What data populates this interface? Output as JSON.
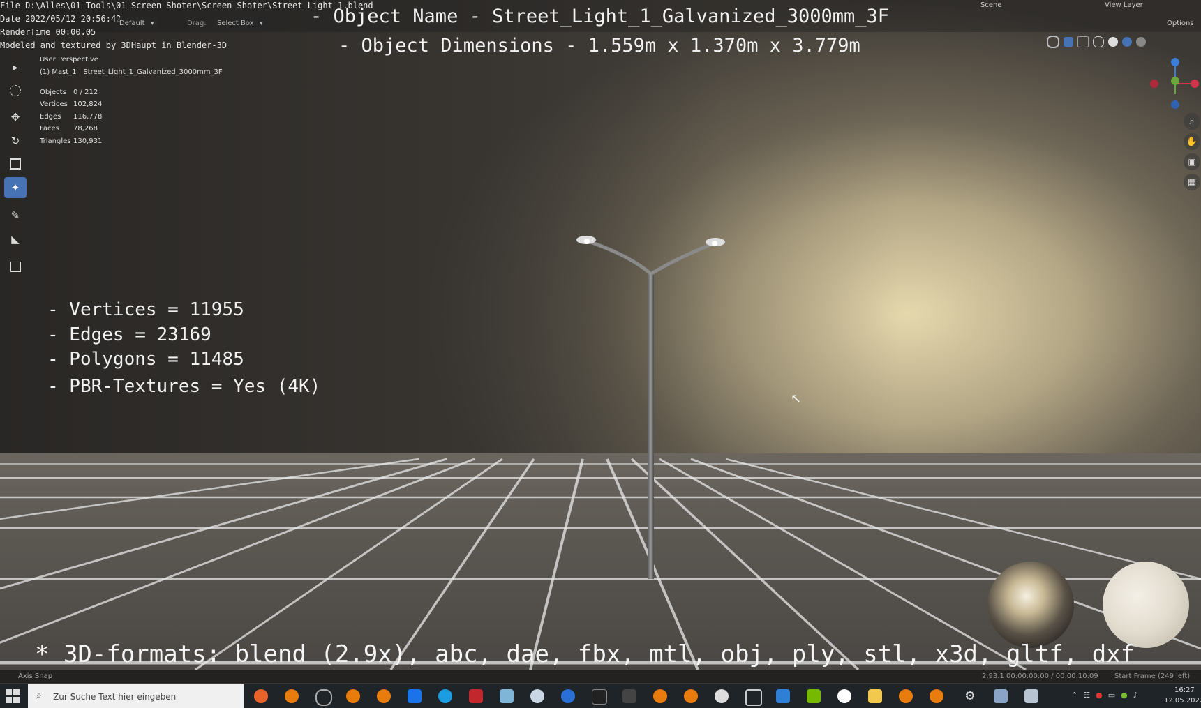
{
  "window": {
    "file_path": "File D:\\Alles\\01_Tools\\01_Screen Shoter\\Screen Shoter\\Street_Light_1.blend",
    "date": "Date 2022/05/12 20:56:42",
    "render_time": "RenderTime 00:00.05",
    "credit": "Modeled and textured by 3DHaupt in Blender-3D"
  },
  "header": {
    "orientation_value": "Default",
    "drag_label": "Drag:",
    "drag_value": "Select Box",
    "scene_label": "Scene",
    "view_layer_label": "View Layer",
    "options_label": "Options"
  },
  "overlay": {
    "object_name": "- Object Name - Street_Light_1_Galvanized_3000mm_3F",
    "object_dimensions": "- Object Dimensions -  1.559m x 1.370m x 3.779m",
    "stats": [
      "- Vertices = 11955",
      "- Edges = 23169",
      "- Polygons = 11485",
      "- PBR-Textures =  Yes (4K)"
    ],
    "formats": "* 3D-formats: blend (2.9x), abc, dae, fbx, mtl, obj, ply, stl, x3d, gltf, dxf"
  },
  "viewport": {
    "perspective": "User Perspective",
    "collection": "(1) Mast_1 | Street_Light_1_Galvanized_3000mm_3F",
    "stats": [
      {
        "key": "Objects",
        "value": "0 / 212"
      },
      {
        "key": "Vertices",
        "value": "102,824"
      },
      {
        "key": "Edges",
        "value": "116,778"
      },
      {
        "key": "Faces",
        "value": "78,268"
      },
      {
        "key": "Triangles",
        "value": "130,931"
      }
    ]
  },
  "statusbar": {
    "axis_snap": "Axis Snap",
    "version_time": "2.93.1  00:00:00:00 / 00:00:10:09",
    "start_frame": "Start Frame (249 left)"
  },
  "taskbar": {
    "search_placeholder": "Zur Suche Text hier eingeben",
    "time": "16:27",
    "date": "12.05.2022"
  },
  "colors": {
    "active_tool": "#4772b3",
    "axis_x": "#d0344a",
    "axis_y": "#6ca63c",
    "axis_z": "#3b7dd8"
  }
}
